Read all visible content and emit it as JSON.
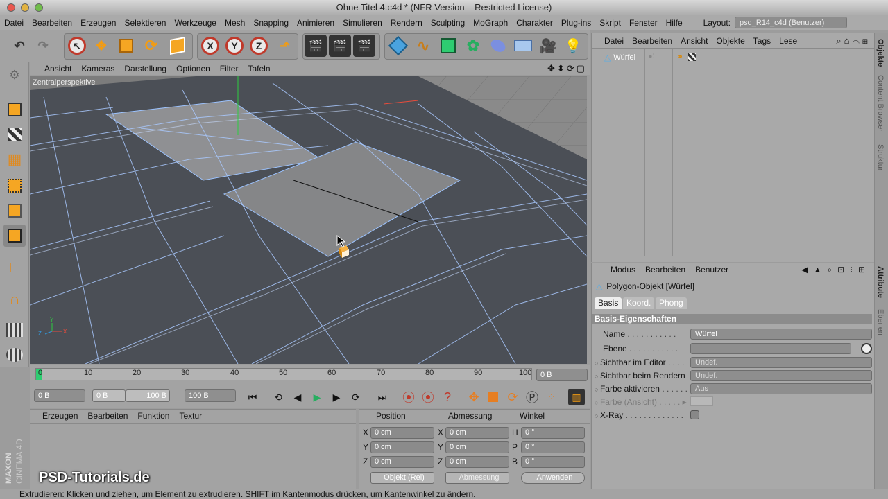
{
  "window": {
    "title": "Ohne Titel 4.c4d * (NFR Version – Restricted License)"
  },
  "menu": [
    "Datei",
    "Bearbeiten",
    "Erzeugen",
    "Selektieren",
    "Werkzeuge",
    "Mesh",
    "Snapping",
    "Animieren",
    "Simulieren",
    "Rendern",
    "Sculpting",
    "MoGraph",
    "Charakter",
    "Plug-ins",
    "Skript",
    "Fenster",
    "Hilfe"
  ],
  "layout": {
    "label": "Layout:",
    "value": "psd_R14_c4d (Benutzer)"
  },
  "toolbar": {
    "x": "X",
    "y": "Y",
    "z": "Z"
  },
  "viewport": {
    "menu": [
      "Ansicht",
      "Kameras",
      "Darstellung",
      "Optionen",
      "Filter",
      "Tafeln"
    ],
    "label": "Zentralperspektive"
  },
  "timeline": {
    "ticks": [
      "0",
      "10",
      "20",
      "30",
      "40",
      "50",
      "60",
      "70",
      "80",
      "90",
      "100"
    ],
    "current_frame": "0 B",
    "start": "0 B",
    "min": "0 B",
    "max": "100 B",
    "end": "100 B"
  },
  "material_manager": {
    "menu": [
      "Erzeugen",
      "Bearbeiten",
      "Funktion",
      "Textur"
    ]
  },
  "coordinates": {
    "headers": [
      "Position",
      "Abmessung",
      "Winkel"
    ],
    "rows": [
      {
        "a": "X",
        "pos": "0 cm",
        "b": "X",
        "size": "0 cm",
        "c": "H",
        "rot": "0 °"
      },
      {
        "a": "Y",
        "pos": "0 cm",
        "b": "Y",
        "size": "0 cm",
        "c": "P",
        "rot": "0 °"
      },
      {
        "a": "Z",
        "pos": "0 cm",
        "b": "Z",
        "size": "0 cm",
        "c": "B",
        "rot": "0 °"
      }
    ],
    "mode": "Objekt (Rel)",
    "size_mode": "Abmessung",
    "apply": "Anwenden"
  },
  "objects": {
    "menu": [
      "Datei",
      "Bearbeiten",
      "Ansicht",
      "Objekte",
      "Tags",
      "Lese"
    ],
    "items": [
      {
        "name": "Würfel"
      }
    ]
  },
  "attributes": {
    "menu": [
      "Modus",
      "Bearbeiten",
      "Benutzer"
    ],
    "object_title": "Polygon-Objekt [Würfel]",
    "tabs": [
      "Basis",
      "Koord.",
      "Phong"
    ],
    "section": "Basis-Eigenschaften",
    "fields": {
      "name_label": "Name",
      "name_value": "Würfel",
      "ebene_label": "Ebene",
      "sichtbar_editor_label": "Sichtbar im Editor",
      "sichtbar_editor_value": "Undef.",
      "sichtbar_render_label": "Sichtbar beim Rendern",
      "sichtbar_render_value": "Undef.",
      "farbe_aktiv_label": "Farbe aktivieren",
      "farbe_aktiv_value": "Aus",
      "farbe_ansicht_label": "Farbe (Ansicht)",
      "xray_label": "X-Ray"
    }
  },
  "side_tabs": [
    "Objekte",
    "Content Browser",
    "Struktur",
    "Attribute",
    "Ebenen"
  ],
  "status": "Extrudieren: Klicken und ziehen, um Element zu extrudieren. SHIFT im Kantenmodus drücken, um Kantenwinkel zu ändern.",
  "watermark": "PSD-Tutorials.de",
  "branding": {
    "maxon": "MAXON",
    "cinema": "CINEMA 4D"
  }
}
